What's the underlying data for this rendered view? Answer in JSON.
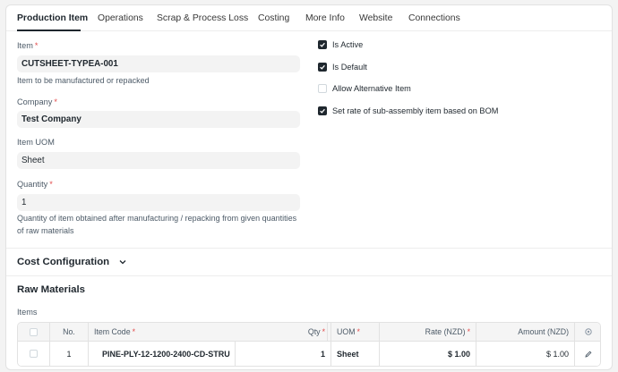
{
  "tabs": [
    "Production Item",
    "Operations",
    "Scrap & Process Loss",
    "Costing",
    "More Info",
    "Website",
    "Connections"
  ],
  "item": {
    "label": "Item",
    "value": "CUTSHEET-TYPEA-001",
    "description": "Item to be manufactured or repacked"
  },
  "company": {
    "label": "Company",
    "value": "Test Company"
  },
  "uom": {
    "label": "Item UOM",
    "value": "Sheet"
  },
  "quantity": {
    "label": "Quantity",
    "value": "1",
    "description_1": "Quantity of item obtained after manufacturing / repacking from given quantities",
    "description_2": "of raw materials"
  },
  "checkboxes": {
    "is_active": {
      "label": "Is Active",
      "checked": true
    },
    "is_default": {
      "label": "Is Default",
      "checked": true
    },
    "allow_alternative": {
      "label": "Allow Alternative Item",
      "checked": false
    },
    "set_rate": {
      "label": "Set rate of sub-assembly item based on BOM",
      "checked": true
    }
  },
  "required_mark": "*",
  "cost_config": {
    "title": "Cost Configuration"
  },
  "raw_materials": {
    "title": "Raw Materials",
    "table_label": "Items",
    "columns": {
      "no": "No.",
      "item_code": "Item Code",
      "qty": "Qty",
      "uom": "UOM",
      "rate": "Rate (NZD)",
      "amount": "Amount (NZD)"
    },
    "rows": [
      {
        "no": "1",
        "item_code": "PINE-PLY-12-1200-2400-CD-STRU",
        "qty": "1",
        "uom": "Sheet",
        "rate": "$ 1.00",
        "amount": "$ 1.00"
      }
    ]
  }
}
